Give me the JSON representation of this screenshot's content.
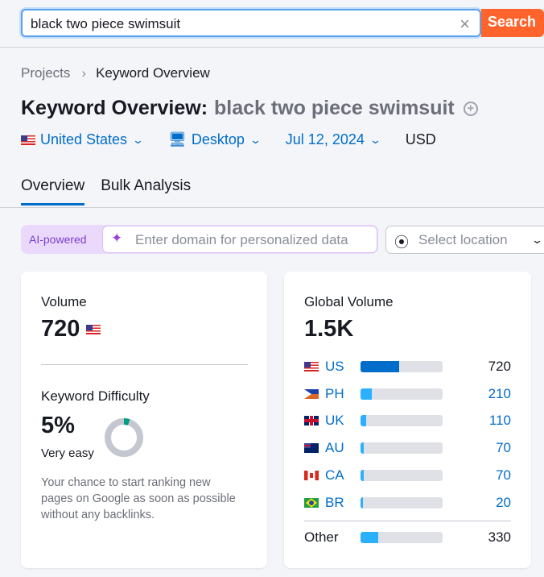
{
  "search": {
    "value": "black two piece swimsuit",
    "button": "Search",
    "clear_icon": "close-icon"
  },
  "breadcrumb": {
    "items": [
      "Projects",
      "Keyword Overview"
    ]
  },
  "header": {
    "title": "Keyword Overview:",
    "keyword": "black two piece swimsuit"
  },
  "filters": {
    "country": "United States",
    "device": "Desktop",
    "date": "Jul 12, 2024",
    "currency": "USD"
  },
  "tabs": [
    {
      "label": "Overview",
      "active": true
    },
    {
      "label": "Bulk Analysis",
      "active": false
    }
  ],
  "ai": {
    "badge": "AI-powered",
    "placeholder": "Enter domain for personalized data"
  },
  "location": {
    "placeholder": "Select location"
  },
  "volume": {
    "label": "Volume",
    "value": "720"
  },
  "difficulty": {
    "label": "Keyword Difficulty",
    "value": "5%",
    "percent": 5,
    "rating": "Very easy",
    "description": "Your chance to start ranking new pages on Google as soon as possible without any backlinks.",
    "color": "#009f81"
  },
  "global": {
    "label": "Global Volume",
    "value": "1.5K",
    "countries": [
      {
        "code": "US",
        "value": "720",
        "share": 47
      },
      {
        "code": "PH",
        "value": "210",
        "share": 14
      },
      {
        "code": "UK",
        "value": "110",
        "share": 7
      },
      {
        "code": "AU",
        "value": "70",
        "share": 4
      },
      {
        "code": "CA",
        "value": "70",
        "share": 4
      },
      {
        "code": "BR",
        "value": "20",
        "share": 3
      }
    ],
    "other": {
      "label": "Other",
      "value": "330",
      "share": 22
    }
  },
  "colors": {
    "accent": "#006dca",
    "search_button": "#ff642d",
    "bar_primary": "#006dca",
    "bar_secondary": "#2bb0ff"
  }
}
